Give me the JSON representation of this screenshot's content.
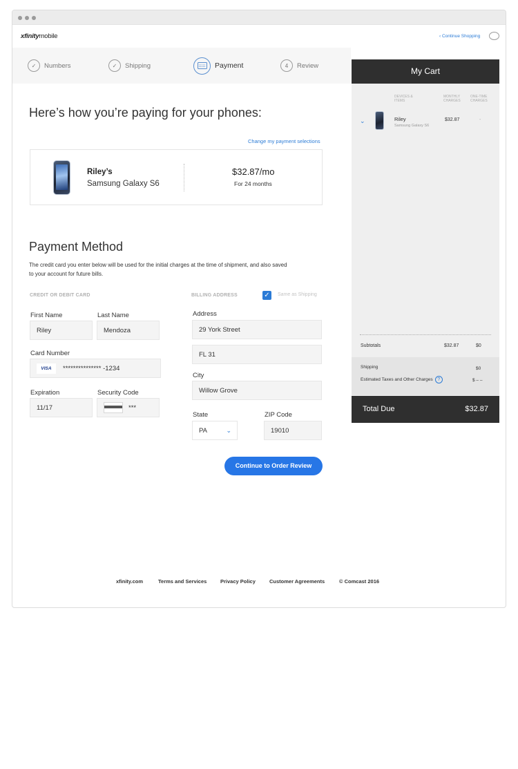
{
  "brand": {
    "logo_bold": "xfinity",
    "logo_light": "mobile"
  },
  "nav": {
    "continue_shopping": "Continue Shopping"
  },
  "steps": [
    {
      "num": "✓",
      "label": "Numbers"
    },
    {
      "num": "✓",
      "label": "Shipping"
    },
    {
      "num": "",
      "label": "Payment"
    },
    {
      "num": "4",
      "label": "Review"
    }
  ],
  "summary": {
    "headline": "Here’s how you’re paying for your phones:",
    "change_link": "Change my payment selections",
    "owner": "Riley’s",
    "model": "Samsung Galaxy S6",
    "price": "$32.87/mo",
    "term": "For 24 months"
  },
  "payment": {
    "title": "Payment Method",
    "description": "The credit card you enter below will be used for the initial charges at the time of shipment, and also saved to your account for future bills.",
    "card_section": "CREDIT OR DEBIT CARD",
    "billing_section": "BILLING ADDRESS",
    "same_as_shipping": "Same as Shipping",
    "first_name_label": "First Name",
    "first_name": "Riley",
    "last_name_label": "Last Name",
    "last_name": "Mendoza",
    "card_number_label": "Card Number",
    "card_brand": "VISA",
    "card_number": "*************** -1234",
    "expiration_label": "Expiration",
    "expiration": "11/17",
    "security_label": "Security Code",
    "security": "***",
    "address_label": "Address",
    "address1": "29 York Street",
    "address2": "FL 31",
    "city_label": "City",
    "city": "Willow Grove",
    "state_label": "State",
    "state": "PA",
    "zip_label": "ZIP Code",
    "zip": "19010",
    "continue_button": "Continue to Order Review"
  },
  "cart": {
    "title": "My Cart",
    "col_devices": "DEVICES & ITEMS",
    "col_monthly": "MONTHLY CHARGES",
    "col_onetime": "ONE-TIME CHARGES",
    "item_name": "Riley",
    "item_sub": "Samsung Galaxy S6",
    "item_monthly": "$32.87",
    "item_onetime": "-",
    "subtotals_label": "Subtotals",
    "subtotal_monthly": "$32.87",
    "subtotal_onetime": "$0",
    "shipping_label": "Shipping",
    "shipping_value": "$0",
    "taxes_label": "Estimated Taxes and Other Charges",
    "taxes_value": "$ – –",
    "total_label": "Total Due",
    "total_value": "$32.87"
  },
  "footer": {
    "site": "xfinity.com",
    "terms": "Terms and Services",
    "privacy": "Privacy Policy",
    "agreements": "Customer Agreements",
    "copyright": "© Comcast 2016"
  }
}
